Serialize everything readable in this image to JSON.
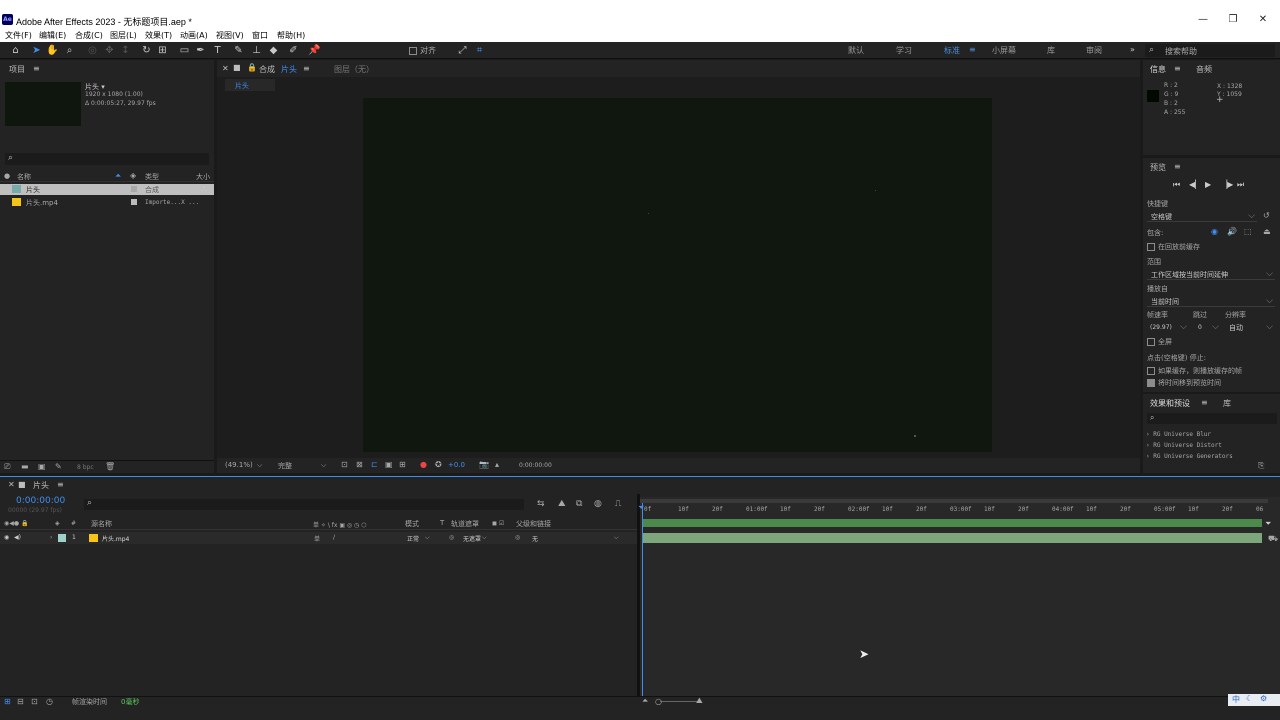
{
  "window": {
    "title": "Adobe After Effects 2023 - 无标题项目.aep *",
    "app_icon": "Ae",
    "min": "—",
    "max": "❐",
    "close": "✕"
  },
  "menus": [
    "文件(F)",
    "编辑(E)",
    "合成(C)",
    "图层(L)",
    "效果(T)",
    "动画(A)",
    "视图(V)",
    "窗口",
    "帮助(H)"
  ],
  "toolbar": {
    "snap_label": "对齐",
    "workspaces": [
      "默认",
      "学习",
      "标准",
      "小屏幕",
      "库",
      "审阅"
    ],
    "active_workspace": "标准",
    "more": "»",
    "search_placeholder": "搜索帮助"
  },
  "project": {
    "tab": "项目",
    "comp_name": "片头 ▾",
    "comp_res": "1920 x 1080 (1.00)",
    "comp_dur": "Δ 0:00:05:27, 29.97 fps",
    "search_icon": "⌕",
    "col_name": "名称",
    "col_type": "类型",
    "col_size": "大小",
    "items": [
      {
        "name": "片头",
        "type": "合成",
        "selected": true
      },
      {
        "name": "片头.mp4",
        "type": "Importe...X ..."
      }
    ],
    "bpc": "8 bpc"
  },
  "viewer": {
    "tab_comp": "合成",
    "tab_comp_name": "片头",
    "tab_layer": "图层（无）",
    "breadcrumb": "片头",
    "zoom": "(49.1%)",
    "resolution": "完整",
    "exposure": "+0.0",
    "timecode": "0:00:00:00"
  },
  "info": {
    "tab_info": "信息",
    "tab_audio": "音频",
    "r": "R : 2",
    "g": "G : 9",
    "b": "B : 2",
    "a": "A : 255",
    "x": "X : 1328",
    "y": "Y : 1059"
  },
  "preview": {
    "tab": "预览",
    "shortcut_label": "快捷键",
    "shortcut_value": "空格键",
    "include_label": "包含:",
    "cache_before": "在回放前缓存",
    "range_label": "范围",
    "range_value": "工作区域按当前时间延伸",
    "playfrom_label": "播放自",
    "playfrom_value": "当前时间",
    "fps_label": "帧速率",
    "skip_label": "跳过",
    "res_label": "分辨率",
    "fps_value": "(29.97)",
    "skip_value": "0",
    "res_value": "自动",
    "fullscreen": "全屏",
    "stop_label": "点击(空格键) 停止:",
    "if_cached": "如果缓存，则播放缓存的帧",
    "move_time": "将时间移到预览时间"
  },
  "effects": {
    "tab": "效果和预设",
    "tab_lib": "库",
    "search_icon": "⌕",
    "items": [
      "RG Universe Blur",
      "RG Universe Distort",
      "RG Universe Generators"
    ]
  },
  "timeline": {
    "tab": "片头",
    "timecode": "0:00:00:00",
    "frames": "00000 (29.97 fps)",
    "search_icon": "⌕",
    "col_source": "源名称",
    "col_switches": "单 ✧ \\ fx ▣ ◎ ◷ ⬡",
    "col_mode": "模式",
    "col_t": "T",
    "col_trkmat": "轨道遮罩",
    "col_parent": "父级和链接",
    "layer": {
      "index": "1",
      "name": "片头.mp4",
      "mode": "正常",
      "trkmat": "无遮罩",
      "parent": "无"
    },
    "ruler": [
      "0f",
      "10f",
      "20f",
      "01:00f",
      "10f",
      "20f",
      "02:00f",
      "10f",
      "20f",
      "03:00f",
      "10f",
      "20f",
      "04:00f",
      "10f",
      "20f",
      "05:00f",
      "10f",
      "20f",
      "06"
    ],
    "render_label": "帧渲染时间",
    "render_value": "0毫秒"
  },
  "colors": {
    "accent": "#3f8ef0",
    "layer_label": "#f5c518",
    "bar": "#7da77b"
  }
}
